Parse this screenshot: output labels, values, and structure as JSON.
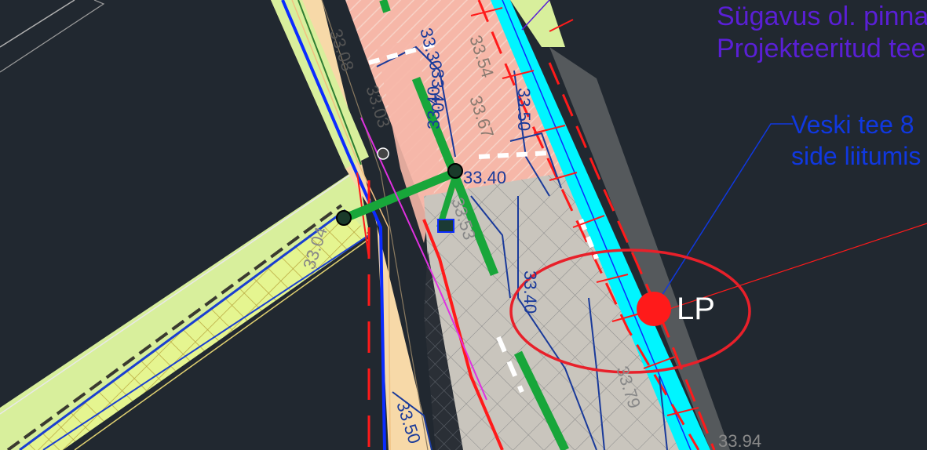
{
  "annotations": {
    "depth_line": "Sügavus ol. pinna",
    "project_line": "Projekteeritud tee",
    "callout_line1": "Veski tee 8",
    "callout_line2": "side liitumis"
  },
  "marker": {
    "label": "LP",
    "color": "#ff1a1a"
  },
  "elevations": [
    "33.30",
    "33.40",
    "33.54",
    "33.50",
    "33.40",
    "33.67",
    "33.40",
    "33.03",
    "33.08",
    "33.04",
    "33.53",
    "33.40",
    "33.50",
    "33.79",
    "33.94"
  ],
  "colors": {
    "background": "#212830",
    "road_fill": "#f7d9a8",
    "pavement_fill": "#c9c5bd",
    "pink_fill": "#f4b3a6",
    "path_fill": "#d8ef9c",
    "utility_cyan": "#00f5ff",
    "utility_green": "#18a63a",
    "utility_blue": "#0b2cff",
    "red_line": "#ff1a1a"
  }
}
